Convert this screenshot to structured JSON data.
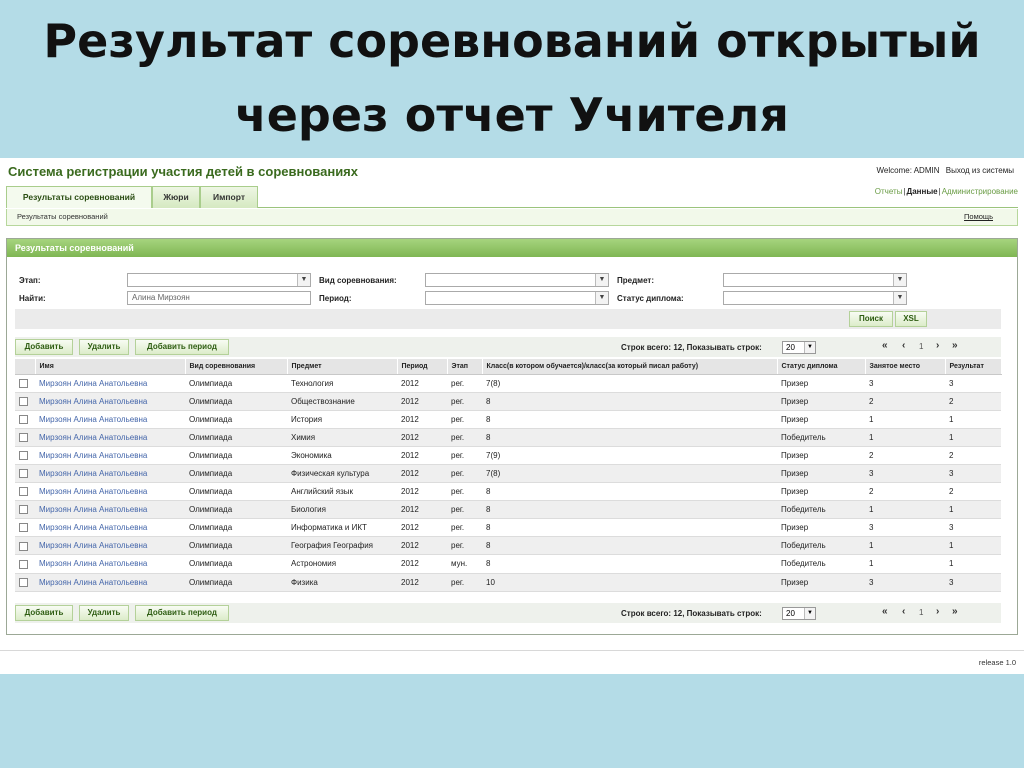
{
  "slide": {
    "title_line1": "Результат соревнований открытый",
    "title_line2": "через отчет Учителя"
  },
  "app": {
    "title": "Система регистрации участия детей в соревнованиях",
    "welcome": "Welcome: ADMIN",
    "logout": "Выход из системы",
    "release": "release 1.0"
  },
  "tabs": [
    "Результаты соревнований",
    "Жюри",
    "Импорт"
  ],
  "toplinks": {
    "reports": "Отчеты",
    "data": "Данные",
    "admin": "Администрирование"
  },
  "subnav": {
    "crumb": "Результаты соревнований",
    "help": "Помощь"
  },
  "panel": {
    "title": "Результаты соревнований"
  },
  "filters": {
    "stage_label": "Этап:",
    "search_label": "Найти:",
    "search_value": "Алина Мирзоян",
    "type_label": "Вид соревнования:",
    "period_label": "Период:",
    "subject_label": "Предмет:",
    "diploma_label": "Статус диплома:"
  },
  "buttons": {
    "search": "Поиск",
    "xsl": "XSL",
    "add": "Добавить",
    "delete": "Удалить",
    "add_period": "Добавить период"
  },
  "paging": {
    "count_text": "Строк всего: 12, Показывать строк:",
    "page_size": "20",
    "first": "«",
    "prev": "‹",
    "page": "1",
    "next": "›",
    "last": "»"
  },
  "table": {
    "columns": [
      "Имя",
      "Вид соревнования",
      "Предмет",
      "Период",
      "Этап",
      "Класс(в котором обучается)/класс(за который писал работу)",
      "Статус диплома",
      "Занятое место",
      "Результат"
    ],
    "rows": [
      [
        "Мирзоян Алина Анатольевна",
        "Олимпиада",
        "Технология",
        "2012",
        "рег.",
        "7(8)",
        "Призер",
        "3",
        "3"
      ],
      [
        "Мирзоян Алина Анатольевна",
        "Олимпиада",
        "Обществознание",
        "2012",
        "рег.",
        "8",
        "Призер",
        "2",
        "2"
      ],
      [
        "Мирзоян Алина Анатольевна",
        "Олимпиада",
        "История",
        "2012",
        "рег.",
        "8",
        "Призер",
        "1",
        "1"
      ],
      [
        "Мирзоян Алина Анатольевна",
        "Олимпиада",
        "Химия",
        "2012",
        "рег.",
        "8",
        "Победитель",
        "1",
        "1"
      ],
      [
        "Мирзоян Алина Анатольевна",
        "Олимпиада",
        "Экономика",
        "2012",
        "рег.",
        "7(9)",
        "Призер",
        "2",
        "2"
      ],
      [
        "Мирзоян Алина Анатольевна",
        "Олимпиада",
        "Физическая культура",
        "2012",
        "рег.",
        "7(8)",
        "Призер",
        "3",
        "3"
      ],
      [
        "Мирзоян Алина Анатольевна",
        "Олимпиада",
        "Английский язык",
        "2012",
        "рег.",
        "8",
        "Призер",
        "2",
        "2"
      ],
      [
        "Мирзоян Алина Анатольевна",
        "Олимпиада",
        "Биология",
        "2012",
        "рег.",
        "8",
        "Победитель",
        "1",
        "1"
      ],
      [
        "Мирзоян Алина Анатольевна",
        "Олимпиада",
        "Информатика и ИКТ",
        "2012",
        "рег.",
        "8",
        "Призер",
        "3",
        "3"
      ],
      [
        "Мирзоян Алина Анатольевна",
        "Олимпиада",
        "География География",
        "2012",
        "рег.",
        "8",
        "Победитель",
        "1",
        "1"
      ],
      [
        "Мирзоян Алина Анатольевна",
        "Олимпиада",
        "Астрономия",
        "2012",
        "мун.",
        "8",
        "Победитель",
        "1",
        "1"
      ],
      [
        "Мирзоян Алина Анатольевна",
        "Олимпиада",
        "Физика",
        "2012",
        "рег.",
        "10",
        "Призер",
        "3",
        "3"
      ]
    ]
  }
}
